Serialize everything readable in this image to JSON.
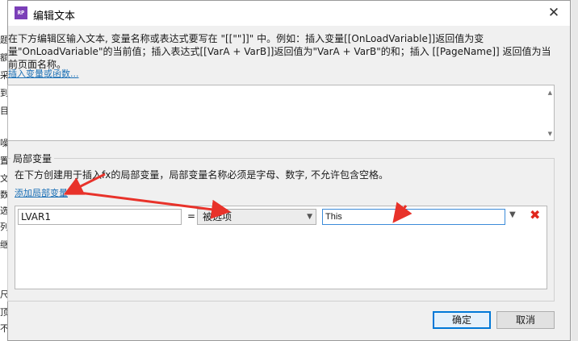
{
  "background_fragments": [
    "题",
    "额",
    "采",
    "到",
    "目",
    "噪",
    "置",
    "文",
    "数",
    "选",
    "列",
    "继",
    "尺",
    "顶",
    "不"
  ],
  "dialog": {
    "app_icon": "RP",
    "title": "编辑文本",
    "close_glyph": "✕",
    "description": "在下方编辑区输入文本, 变量名称或表达式要写在 \"[[\"\"]]\" 中。例如：插入变量[[OnLoadVariable]]返回值为变量\"OnLoadVariable\"的当前值；插入表达式[[VarA + VarB]]返回值为\"VarA + VarB\"的和；插入 [[PageName]] 返回值为当前页面名称。",
    "insert_link": "插入变量或函数...",
    "editor_text": ""
  },
  "local_vars": {
    "title": "局部变量",
    "description": "在下方创建用于插入fx的局部变量，局部变量名称必须是字母、数字, 不允许包含空格。",
    "add_link": "添加局部变量",
    "rows": [
      {
        "name": "LVAR1",
        "equals": "=",
        "type": "被选项",
        "value": "This"
      }
    ]
  },
  "buttons": {
    "ok": "确定",
    "cancel": "取消"
  },
  "colors": {
    "annotation_arrow": "#e8322a",
    "link": "#1a6fb5",
    "delete": "#e0261c",
    "focus": "#3c8bd9"
  }
}
